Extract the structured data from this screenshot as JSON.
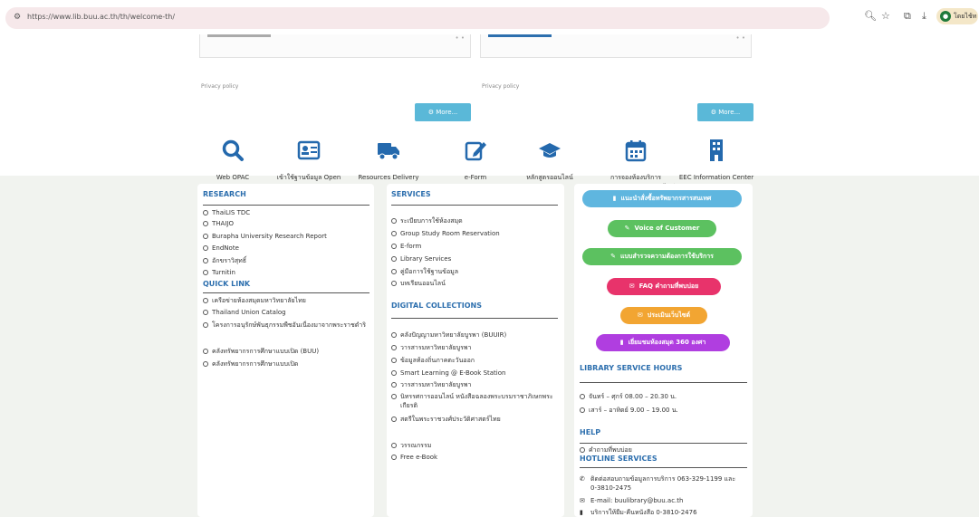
{
  "browser": {
    "url": "https://www.lib.buu.ac.th/th/welcome-th/",
    "profile_name": "โดยไช้ท"
  },
  "upper": {
    "privacy_left": "Privacy policy",
    "privacy_right": "Privacy policy",
    "more_left": "⚙ More...",
    "more_right": "⚙ More..."
  },
  "services_icons": [
    {
      "label": "Web OPAC",
      "icon": "search-icon"
    },
    {
      "label": "เข้าใช้ฐานข้อมูล Open Athens",
      "icon": "id-card-icon"
    },
    {
      "label": "Resources Delivery",
      "icon": "truck-icon"
    },
    {
      "label": "e-Form",
      "icon": "edit-icon"
    },
    {
      "label": "หลักสูตรออนไลน์",
      "icon": "graduation-cap-icon"
    },
    {
      "label": "การจองห้องบริการสารสนเทศ/ห้องสมุดออนไลน์",
      "icon": "calendar-icon"
    },
    {
      "label": "EEC Information Center",
      "icon": "building-icon"
    }
  ],
  "research": {
    "title": "RESEARCH",
    "items": [
      "ThaiLIS TDC",
      "THAIJO",
      "Burapha University Research Report",
      "EndNote",
      "อักขราวิสุทธิ์",
      "Turnitin"
    ]
  },
  "quicklink": {
    "title": "QUICK LINK",
    "items": [
      "เครือข่ายห้องสมุดมหาวิทยาลัยไทย",
      "Thailand Union Catalog",
      "โครงการอนุรักษ์พันธุกรรมพืชอันเนื่องมาจากพระราชดำริ",
      "คลังทรัพยากรการศึกษาแบบเปิด (BUU)",
      "คลังทรัพยากรการศึกษาแบบเปิด"
    ]
  },
  "services": {
    "title": "SERVICES",
    "items": [
      "ระเบียบการใช้ห้องสมุด",
      "Group Study Room Reservation",
      "E-form",
      "Library Services",
      "คู่มือการใช้ฐานข้อมูล",
      "บทเรียนออนไลน์"
    ]
  },
  "digital": {
    "title": "DIGITAL COLLECTIONS",
    "items": [
      "คลังปัญญามหาวิทยาลัยบูรพา (BUUIR)",
      "วารสารมหาวิทยาลัยบูรพา",
      "ข้อมูลท้องถิ่นภาคตะวันออก",
      "Smart Learning @ E-Book Station",
      "วารสารมหาวิทยาลัยบูรพา",
      "นิทรรศการออนไลน์ หนังสือฉลองพระบรมราชาภิเษกพระเกียรติ",
      "สตรีในพระราชวงศ์ประวัติศาสตร์ไทย",
      "วรรณกรรม",
      "Free e-Book"
    ]
  },
  "right": {
    "buttons": [
      {
        "label": "แนะนำสั่งซื้อทรัพยากรสารสนเทศ",
        "icon": "book-icon",
        "color": "#5fb6df"
      },
      {
        "label": "Voice of Customer",
        "icon": "pencil-icon",
        "color": "#5cc160"
      },
      {
        "label": "แบบสำรวจความต้องการใช้บริการ",
        "icon": "pencil-icon",
        "color": "#5cc160"
      },
      {
        "label": "FAQ คำถามที่พบบ่อย",
        "icon": "chat-icon",
        "color": "#e8336b"
      },
      {
        "label": "ประเมินเว็บไซต์",
        "icon": "chat-icon",
        "color": "#f2a532"
      },
      {
        "label": "เยี่ยมชมห้องสมุด 360 องศา",
        "icon": "book-icon",
        "color": "#b03ee0"
      }
    ],
    "hours_title": "LIBRARY SERVICE HOURS",
    "hours": [
      "จันทร์ – ศุกร์ 08.00 – 20.30 น.",
      "เสาร์ – อาทิตย์ 9.00 – 19.00 น."
    ],
    "help_title": "HELP",
    "help_items": [
      "คำถามที่พบบ่อย"
    ],
    "hotline_title": "HOTLINE SERVICES",
    "hotline": [
      {
        "icon": "phone-icon",
        "text": "ติดต่อสอบถามข้อมูลการบริการ 063-329-1199 และ 0-3810-2475"
      },
      {
        "icon": "mail-icon",
        "text": "E-mail: buulibrary@buu.ac.th"
      },
      {
        "icon": "doc-icon",
        "text": "บริการให้ยืม-คืนหนังสือ 0-3810-2476"
      }
    ]
  }
}
